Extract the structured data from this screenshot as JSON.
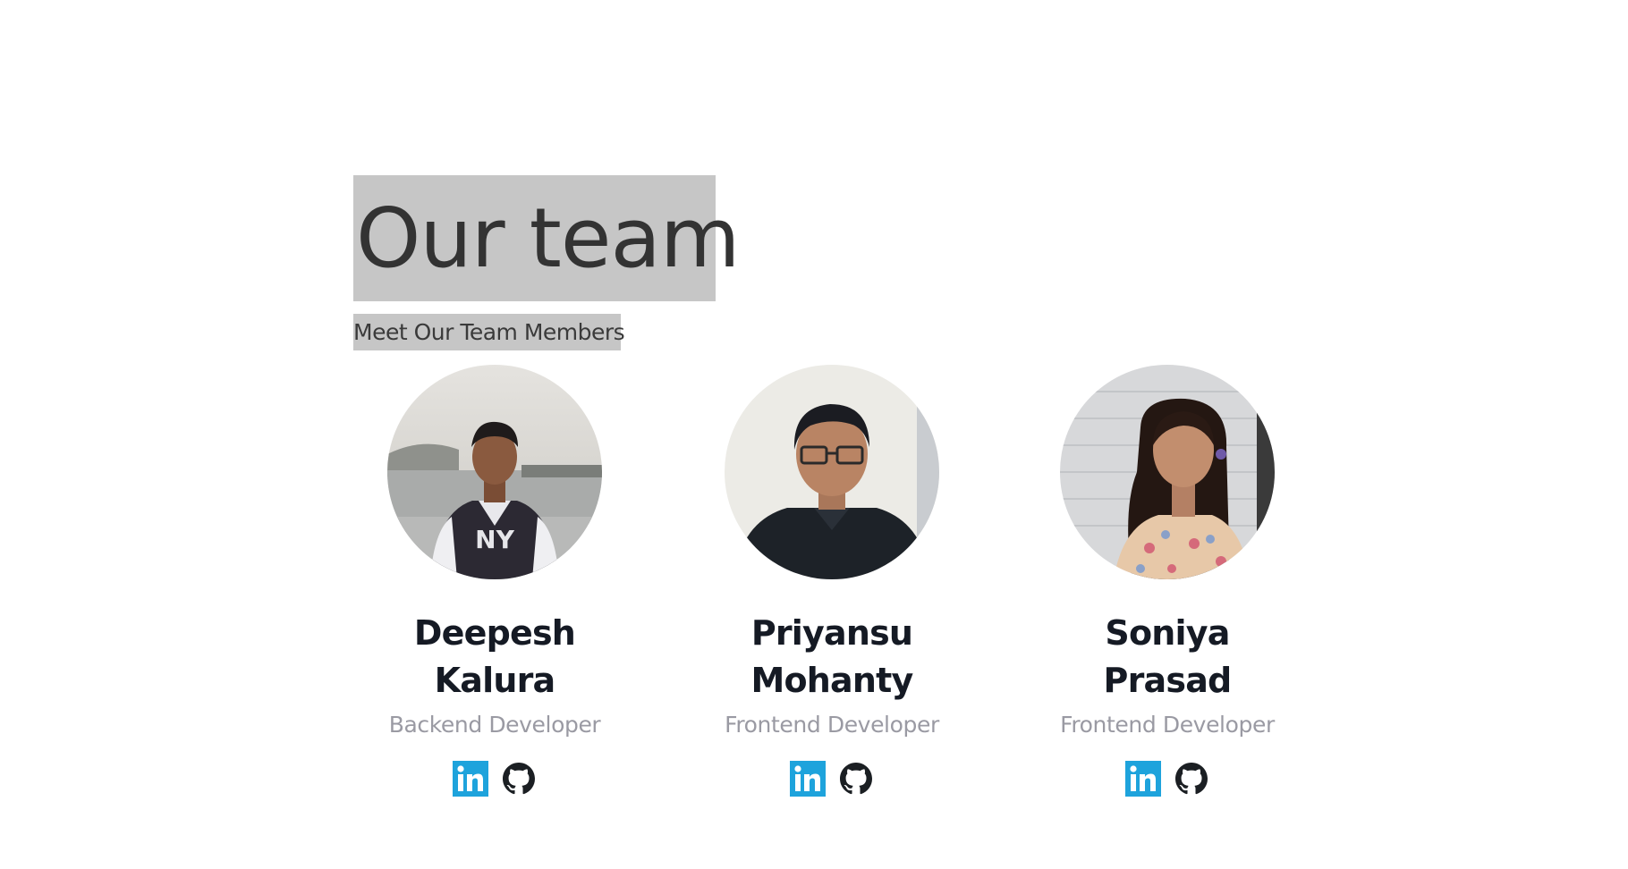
{
  "header": {
    "title": "Our team",
    "subtitle": "Meet Our Team Members"
  },
  "members": [
    {
      "name": "Deepesh Kalura",
      "role": "Backend Developer"
    },
    {
      "name": "Priyansu Mohanty",
      "role": "Frontend Developer"
    },
    {
      "name": "Soniya Prasad",
      "role": "Frontend Developer"
    }
  ],
  "icons": {
    "linkedin": "linkedin-icon",
    "github": "github-icon"
  },
  "colors": {
    "linkedin": "#1ea3dc",
    "github": "#1b1f23",
    "name": "#151a24",
    "role": "#9a9aa3",
    "highlight": "#c6c6c6"
  }
}
